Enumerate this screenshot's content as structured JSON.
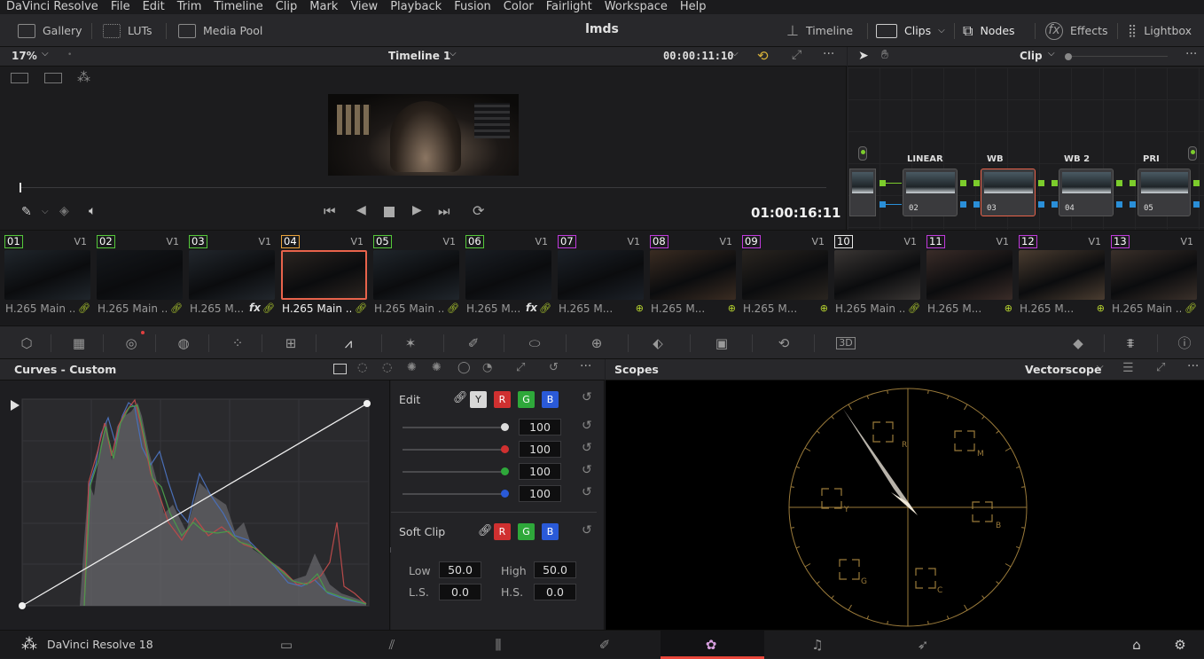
{
  "menu": {
    "app": "DaVinci Resolve",
    "items": [
      "File",
      "Edit",
      "Trim",
      "Timeline",
      "Clip",
      "Mark",
      "View",
      "Playback",
      "Fusion",
      "Color",
      "Fairlight",
      "Workspace",
      "Help"
    ]
  },
  "toolbar": {
    "gallery": "Gallery",
    "luts": "LUTs",
    "media_pool": "Media Pool",
    "project_title": "lmds",
    "timeline": "Timeline",
    "clips": "Clips",
    "nodes": "Nodes",
    "effects": "Effects",
    "lightbox": "Lightbox"
  },
  "viewer": {
    "zoom": "17%",
    "timeline_name": "Timeline 1",
    "source_timecode": "00:00:11:10",
    "record_timecode": "01:00:16:11",
    "playhead_progress": 0.0
  },
  "node_editor": {
    "mode": "Clip",
    "nodes": [
      {
        "label": "LINEAR",
        "num": "02"
      },
      {
        "label": "WB",
        "num": "03"
      },
      {
        "label": "WB 2",
        "num": "04"
      },
      {
        "label": "PRI",
        "num": "05"
      }
    ]
  },
  "clips": [
    {
      "num": "01",
      "track": "V1",
      "codec": "H.265 Main ...",
      "color": "#55c83a"
    },
    {
      "num": "02",
      "track": "V1",
      "codec": "H.265 Main ...",
      "color": "#55c83a"
    },
    {
      "num": "03",
      "track": "V1",
      "codec": "H.265 M...",
      "fx": "fx",
      "color": "#55c83a"
    },
    {
      "num": "04",
      "track": "V1",
      "codec": "H.265 Main ...",
      "color": "#e8a23a",
      "selected": true
    },
    {
      "num": "05",
      "track": "V1",
      "codec": "H.265 Main ...",
      "color": "#55c83a"
    },
    {
      "num": "06",
      "track": "V1",
      "codec": "H.265 M...",
      "fx": "fx",
      "color": "#55c83a"
    },
    {
      "num": "07",
      "track": "V1",
      "codec": "H.265 M...",
      "color": "#c03adc"
    },
    {
      "num": "08",
      "track": "V1",
      "codec": "H.265 M...",
      "color": "#c03adc"
    },
    {
      "num": "09",
      "track": "V1",
      "codec": "H.265 M...",
      "color": "#c03adc"
    },
    {
      "num": "10",
      "track": "V1",
      "codec": "H.265 Main ...",
      "color": "#e8e8e8"
    },
    {
      "num": "11",
      "track": "V1",
      "codec": "H.265 M...",
      "color": "#c03adc"
    },
    {
      "num": "12",
      "track": "V1",
      "codec": "H.265 M...",
      "color": "#c03adc"
    },
    {
      "num": "13",
      "track": "V1",
      "codec": "H.265 Main ...",
      "color": "#c03adc"
    }
  ],
  "curves": {
    "title": "Curves - Custom",
    "edit_label": "Edit",
    "channels": [
      "Y",
      "R",
      "G",
      "B"
    ],
    "intensities": [
      "100",
      "100",
      "100",
      "100"
    ],
    "soft_clip_label": "Soft Clip",
    "low_label": "Low",
    "low_value": "50.0",
    "high_label": "High",
    "high_value": "50.0",
    "ls_label": "L.S.",
    "ls_value": "0.0",
    "hs_label": "H.S.",
    "hs_value": "0.0"
  },
  "scopes": {
    "title": "Scopes",
    "mode": "Vectorscope",
    "targets": [
      "R",
      "M",
      "Y",
      "B",
      "G",
      "C"
    ]
  },
  "bottom": {
    "app_name": "DaVinci Resolve 18"
  },
  "colors": {
    "accent_red": "#e8634b",
    "node_green": "#7ccc2c",
    "node_blue": "#2a8fd8",
    "scope_gold": "#9a7a3a"
  }
}
